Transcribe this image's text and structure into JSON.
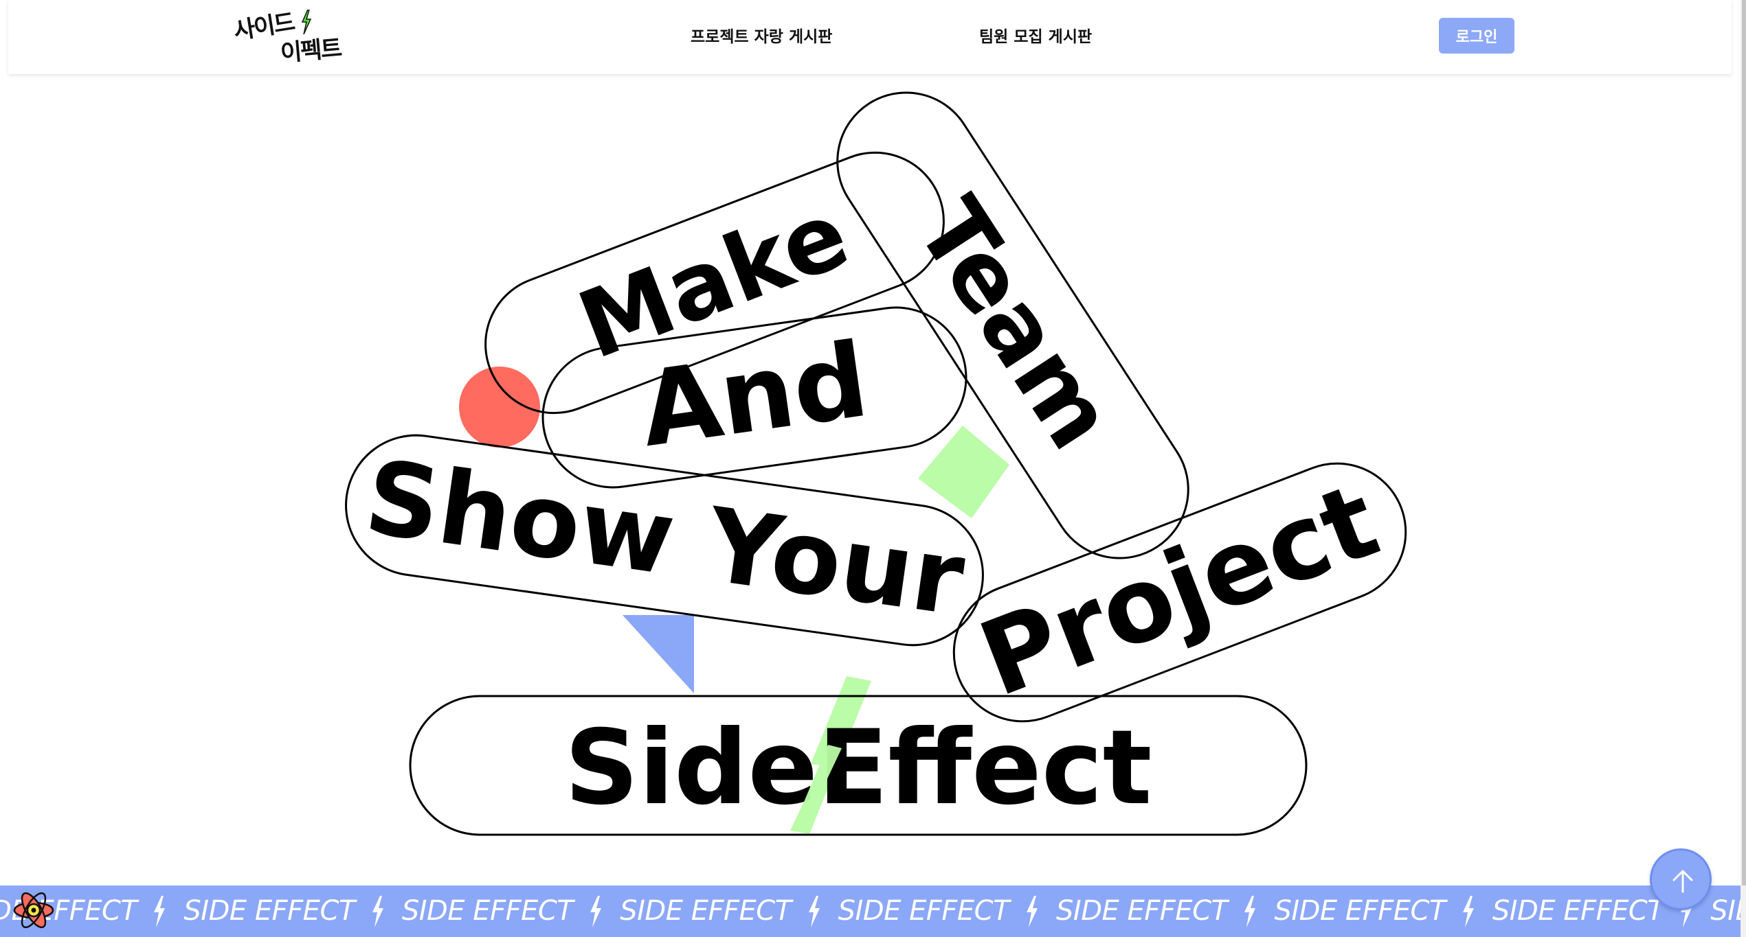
{
  "header": {
    "logo_line1": "사이드",
    "logo_line2": "이펙트",
    "nav": [
      {
        "label": "프로젝트 자랑 게시판"
      },
      {
        "label": "팀원 모집 게시판"
      }
    ],
    "login_label": "로그인"
  },
  "hero": {
    "words": [
      "Make",
      "Team",
      "And",
      "Show Your",
      "Project",
      "SideEffect"
    ]
  },
  "marquee": {
    "text": "SIDE EFFECT",
    "icon": "lightning-bolt-icon"
  },
  "colors": {
    "accent_blue": "#8ba7f7",
    "accent_green": "#bbfca8",
    "accent_red": "#ff6b5e",
    "text": "#111111"
  },
  "icons": {
    "scroll_top": "arrow-up-icon",
    "marquee_badge": "react-atom-icon"
  }
}
